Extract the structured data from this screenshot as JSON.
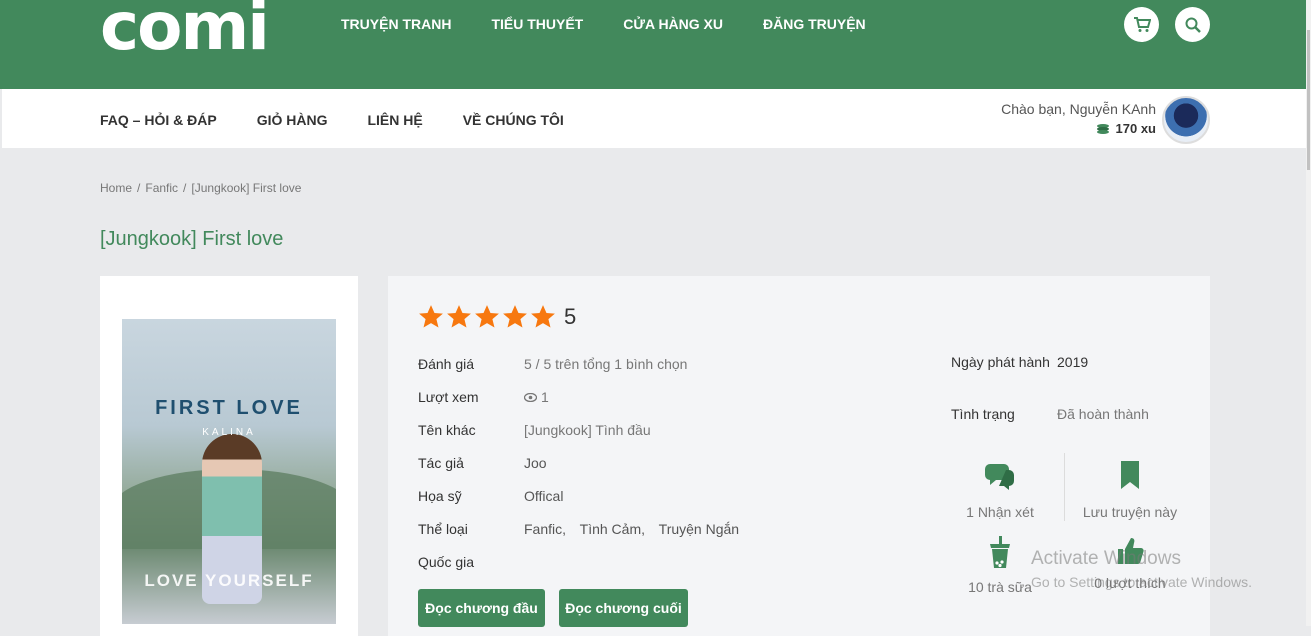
{
  "brand": {
    "logo": "comi"
  },
  "main_nav": [
    "TRUYỆN TRANH",
    "TIỂU THUYẾT",
    "CỬA HÀNG XU",
    "ĐĂNG TRUYỆN"
  ],
  "sub_nav": [
    "FAQ – HỎI & ĐÁP",
    "GIỎ HÀNG",
    "LIÊN HỆ",
    "VỀ CHÚNG TÔI"
  ],
  "user": {
    "greeting": "Chào bạn, Nguyễn KAnh",
    "coins": "170 xu"
  },
  "breadcrumb": [
    "Home",
    "Fanfic",
    "[Jungkook] First love"
  ],
  "title": "[Jungkook] First love",
  "cover": {
    "title": "FIRST LOVE",
    "author_line": "KALINA",
    "footer_text": "LOVE YOURSELF"
  },
  "rating": {
    "score": "5",
    "stars": 5,
    "star_color": "#f7780f"
  },
  "details": [
    {
      "key": "Đánh giá",
      "value": "5 / 5 trên tổng 1 bình chọn"
    },
    {
      "key": "Lượt xem",
      "value": "1"
    },
    {
      "key": "Tên khác",
      "value": "[Jungkook] Tình đầu"
    },
    {
      "key": "Tác giả",
      "value": "Joo"
    },
    {
      "key": "Họa sỹ",
      "value": "Offical"
    },
    {
      "key": "Thể loại",
      "genres": [
        "Fanfic,",
        "Tình Cảm,",
        "Truyện Ngắn"
      ]
    },
    {
      "key": "Quốc gia",
      "value": ""
    }
  ],
  "buttons": {
    "first_chapter": "Đọc chương đầu",
    "last_chapter": "Đọc chương cuối"
  },
  "release": {
    "key": "Ngày phát hành",
    "value": "2019"
  },
  "status": {
    "key": "Tình trạng",
    "value": "Đã hoàn thành"
  },
  "stats": {
    "comments": "1 Nhận xét",
    "save": "Lưu truyện này",
    "milktea": "10 trà sữa",
    "likes": "0 lượt thích"
  },
  "watermark": {
    "line1": "Activate Windows",
    "line2": "Go to Settings to activate Windows."
  },
  "colors": {
    "brand_green": "#42895c",
    "star": "#f7780f"
  }
}
